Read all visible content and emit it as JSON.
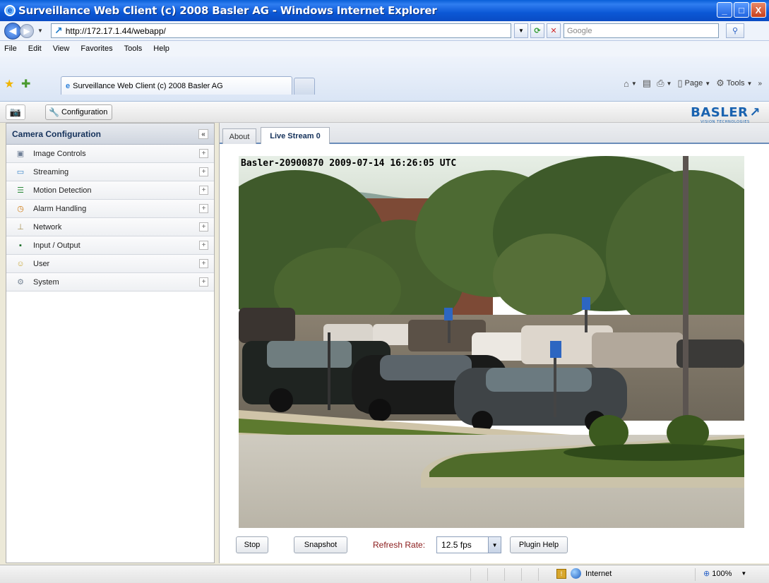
{
  "window": {
    "title": "Surveillance Web Client (c) 2008 Basler AG - Windows Internet Explorer",
    "controls": [
      "_",
      "□",
      "X"
    ]
  },
  "addressbar": {
    "url": "http://172.17.1.44/webapp/",
    "search_placeholder": "Google"
  },
  "menu": [
    "File",
    "Edit",
    "View",
    "Favorites",
    "Tools",
    "Help"
  ],
  "browser_tab": {
    "label": "Surveillance Web Client (c) 2008 Basler AG"
  },
  "command_bar": {
    "page": "Page",
    "tools": "Tools"
  },
  "app_toolbar": {
    "configuration_label": "Configuration",
    "logo": "BASLER",
    "logo_sub": "VISION TECHNOLOGIES"
  },
  "sidebar": {
    "title": "Camera Configuration",
    "collapse_glyph": "«",
    "items": [
      {
        "label": "Image Controls",
        "icon": "image-controls-icon",
        "glyph": "▣",
        "color": "#6f7f96"
      },
      {
        "label": "Streaming",
        "icon": "streaming-icon",
        "glyph": "▭",
        "color": "#3b86c9"
      },
      {
        "label": "Motion Detection",
        "icon": "motion-detection-icon",
        "glyph": "☰",
        "color": "#2d8a3a"
      },
      {
        "label": "Alarm Handling",
        "icon": "alarm-handling-icon",
        "glyph": "◷",
        "color": "#d07a10"
      },
      {
        "label": "Network",
        "icon": "network-icon",
        "glyph": "⊥",
        "color": "#a38b49"
      },
      {
        "label": "Input / Output",
        "icon": "input-output-icon",
        "glyph": "▪",
        "color": "#1e6e2a"
      },
      {
        "label": "User",
        "icon": "user-icon",
        "glyph": "☺",
        "color": "#c8a83a"
      },
      {
        "label": "System",
        "icon": "system-icon",
        "glyph": "⚙",
        "color": "#7a8898"
      }
    ]
  },
  "content_tabs": [
    {
      "label": "About",
      "active": false
    },
    {
      "label": "Live Stream 0",
      "active": true
    }
  ],
  "camera": {
    "overlay": "Basler-20900870 2009-07-14 16:26:05 UTC"
  },
  "stream_controls": {
    "stop": "Stop",
    "snapshot": "Snapshot",
    "refresh_label": "Refresh Rate:",
    "refresh_value": "12.5 fps",
    "plugin_help": "Plugin Help"
  },
  "statusbar": {
    "zone": "Internet",
    "zoom": "100%"
  }
}
